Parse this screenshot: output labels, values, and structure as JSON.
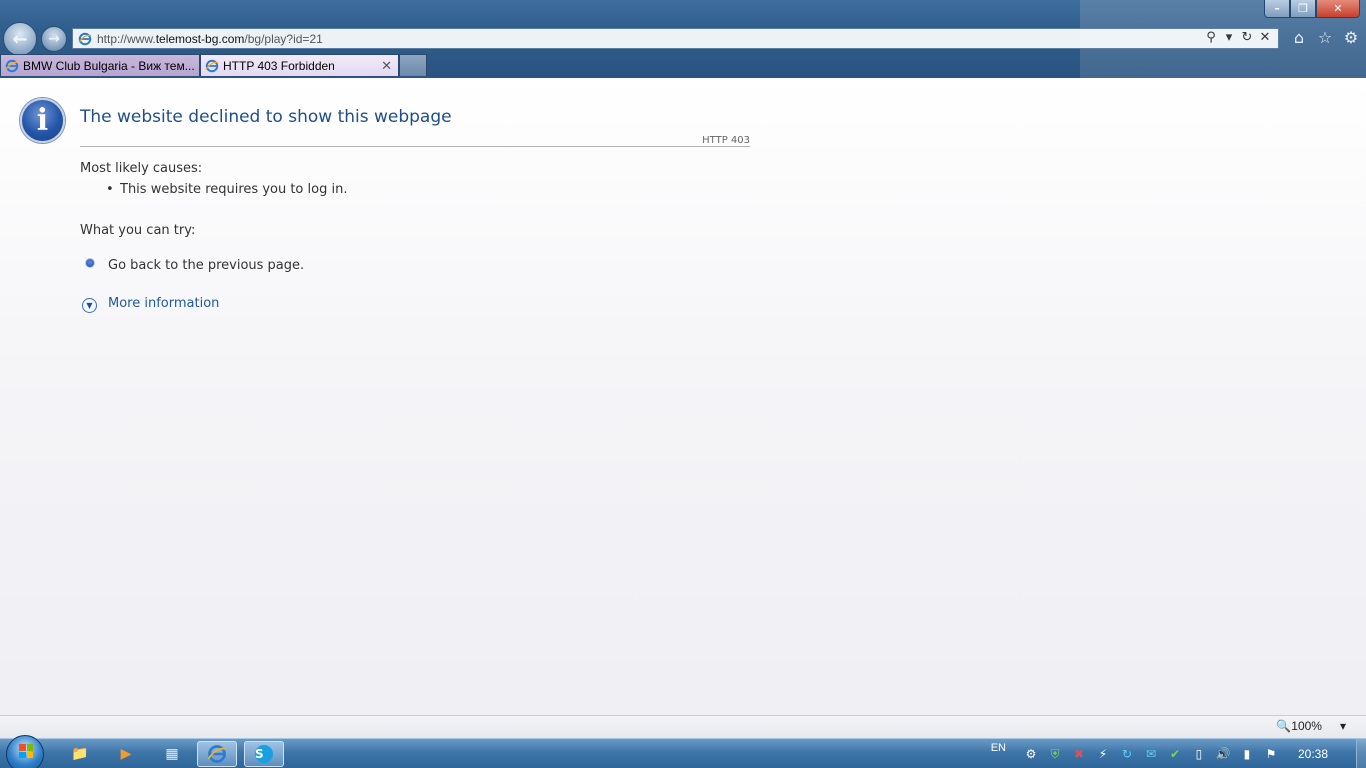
{
  "browser": {
    "address_url_prefix": "http://www.",
    "address_url_domain": "telemost-bg.com",
    "address_url_path": "/bg/play?id=21",
    "tabs": [
      {
        "label": "BMW Club Bulgaria - Виж тем..."
      },
      {
        "label": "HTTP 403 Forbidden"
      }
    ],
    "window_controls": {
      "minimize": "–",
      "maximize": "❐",
      "close": "✕"
    }
  },
  "page": {
    "title": "The website declined to show this webpage",
    "http_code": "HTTP 403",
    "causes_heading": "Most likely causes:",
    "causes": [
      "This website requires you to log in."
    ],
    "try_heading": "What you can try:",
    "try_items": [
      "Go back to the previous page."
    ],
    "more_info": "More information"
  },
  "statusbar": {
    "zoom": "100%"
  },
  "taskbar": {
    "language": "EN",
    "clock": "20:38"
  },
  "colors": {
    "heading": "#1f4e8a",
    "link": "#1f5a9e",
    "taskbar": "#3f76a9"
  }
}
